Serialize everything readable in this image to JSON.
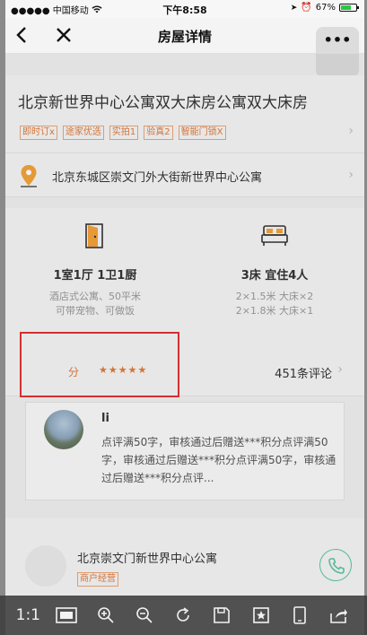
{
  "statusbar": {
    "carrier": "●●●●● 中国移动",
    "time": "下午8:58",
    "battery_text": "67%",
    "battery_level": 0.67
  },
  "nav": {
    "back_icon": "chevron-left-icon",
    "close_icon": "close-icon",
    "title": "房屋详情",
    "more_label": "•••"
  },
  "listing": {
    "title": "北京新世界中心公寓双大床房公寓双大床房",
    "tags": [
      "即时订x",
      "途家优选",
      "实拍1",
      "验真2",
      "智能门锁X"
    ],
    "address": "北京东城区崇文门外大街新世界中心公寓"
  },
  "info": {
    "layout_title": "1室1厅 1卫1厨",
    "layout_sub": [
      "酒店式公寓、50平米",
      "可带宠物、可做饭"
    ],
    "beds_title": "3床 宜住4人",
    "beds_sub": [
      "2×1.5米 大床×2",
      "2×1.8米 大床×1"
    ]
  },
  "rating": {
    "score_label": "分",
    "stars": "★★★★★",
    "star_value": 5,
    "review_count": "451条评论"
  },
  "review": {
    "name": "li",
    "text": "点评满50字，审核通过后赠送***积分点评满50字，审核通过后赠送***积分点评满50字，审核通过后赠送***积分点评..."
  },
  "merchant": {
    "name": "北京崇文门新世界中心公寓",
    "tag": "商户经营"
  },
  "viewer": {
    "ratio_label": "1:1"
  },
  "colors": {
    "accent": "#e07a3a",
    "highlight": "#d2302f",
    "phone_green": "#5cc49f"
  }
}
